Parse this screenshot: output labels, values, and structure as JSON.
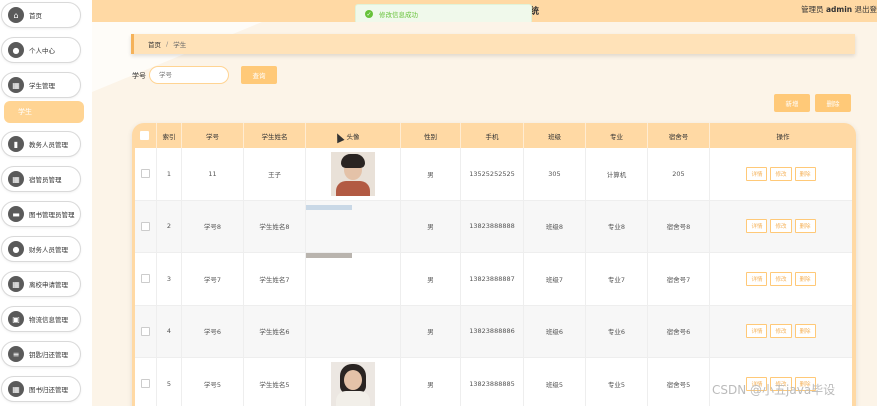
{
  "sidebar": {
    "items": [
      {
        "label": "首页",
        "icon": "home-icon"
      },
      {
        "label": "个人中心",
        "icon": "user-icon"
      },
      {
        "label": "学生管理",
        "icon": "grid-icon"
      },
      {
        "label": "教务人员管理",
        "icon": "chart-icon"
      },
      {
        "label": "宿管员管理",
        "icon": "grid-icon"
      },
      {
        "label": "图书管理员管理",
        "icon": "card-icon"
      },
      {
        "label": "财务人员管理",
        "icon": "user-icon"
      },
      {
        "label": "离校申请管理",
        "icon": "grid-icon"
      },
      {
        "label": "物流信息管理",
        "icon": "truck-icon"
      },
      {
        "label": "钥匙归还管理",
        "icon": "list-icon"
      },
      {
        "label": "图书归还管理",
        "icon": "grid-icon"
      }
    ],
    "active_sub": "学生"
  },
  "header": {
    "title_fragment": "统",
    "admin_prefix": "管理员",
    "admin_name": "admin",
    "logout": "退出登"
  },
  "toast": {
    "text": "修改信息成功",
    "color": "#67c23a"
  },
  "breadcrumb": {
    "home": "首页",
    "separator": "/",
    "current": "学生"
  },
  "search": {
    "label": "学号",
    "placeholder": "学号",
    "button": "查询"
  },
  "actions": {
    "add": "新增",
    "delete": "删除"
  },
  "table": {
    "columns": [
      "",
      "索引",
      "学号",
      "学生姓名",
      "头像",
      "性别",
      "手机",
      "班级",
      "专业",
      "宿舍号",
      "操作"
    ],
    "row_actions": [
      "详情",
      "修改",
      "删除"
    ],
    "rows": [
      {
        "index": "1",
        "student_no": "11",
        "name": "王子",
        "avatar": "photo-male",
        "gender": "男",
        "phone": "13525252525",
        "class": "305",
        "major": "计算机",
        "dorm": "205"
      },
      {
        "index": "2",
        "student_no": "学号8",
        "name": "学生姓名8",
        "avatar": "photo-cropped",
        "gender": "男",
        "phone": "13823888888",
        "class": "班级8",
        "major": "专业8",
        "dorm": "宿舍号8"
      },
      {
        "index": "3",
        "student_no": "学号7",
        "name": "学生姓名7",
        "avatar": "photo-cropped",
        "gender": "男",
        "phone": "13823888887",
        "class": "班级7",
        "major": "专业7",
        "dorm": "宿舍号7"
      },
      {
        "index": "4",
        "student_no": "学号6",
        "name": "学生姓名6",
        "avatar": "none",
        "gender": "男",
        "phone": "13823888886",
        "class": "班级6",
        "major": "专业6",
        "dorm": "宿舍号6"
      },
      {
        "index": "5",
        "student_no": "学号5",
        "name": "学生姓名5",
        "avatar": "photo-female",
        "gender": "男",
        "phone": "13823888885",
        "class": "班级5",
        "major": "专业5",
        "dorm": "宿舍号5"
      }
    ]
  },
  "watermark": "CSDN @小五java毕设",
  "colors": {
    "accent": "#ffc978",
    "header_bg": "#ffd9a4",
    "active_sub": "#ffd493",
    "main_bg": "#fcf4e8"
  }
}
